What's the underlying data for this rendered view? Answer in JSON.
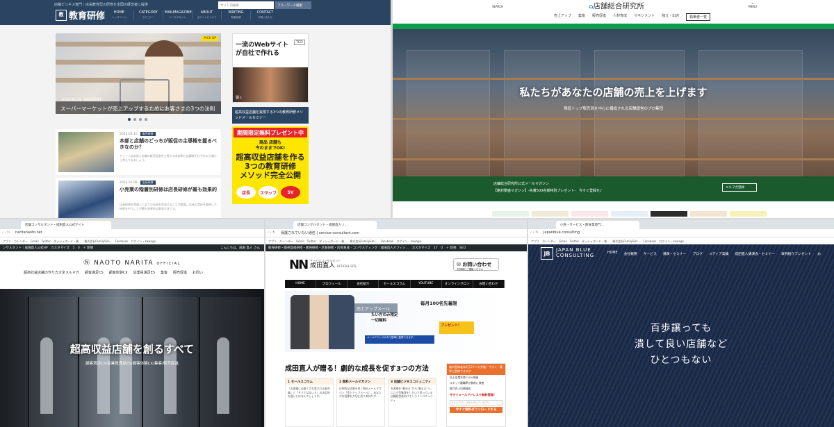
{
  "p1": {
    "tagline": "店舗ビジネス専門｜店長教育型の研修を全国の経営者に提供",
    "logo_icon": "教",
    "logo_text": "教育研修",
    "nav": [
      {
        "label": "HOME",
        "sub": "トップページ"
      },
      {
        "label": "CATEGORY",
        "sub": "カテゴリー"
      },
      {
        "label": "MAILMAGAZINE",
        "sub": "メールマガジン"
      },
      {
        "label": "ABOUT",
        "sub": "当サイトについて"
      },
      {
        "label": "WRITING",
        "sub": "執筆依頼"
      },
      {
        "label": "CONTACT",
        "sub": "お問い合わせ"
      }
    ],
    "search_placeholder": "サイト内検索",
    "search_button": "フリーワード検索",
    "hero": {
      "pickup": "PICK UP",
      "date": "2019.06.21 【店長研修】",
      "caption": "スーパーマーケットが売上アップするためにお客さまの3つの法則"
    },
    "articles": [
      {
        "date": "2022.02.10",
        "badge": "販売研修",
        "title": "本部と店舗のどっちが販促の主導権を握るべきなのか？",
        "excerpt": "チェーン店本部と店舗の販売促進を主導する本部側と店舗側それぞれの立場から考えてみましょう。"
      },
      {
        "date": "2022.02.08",
        "badge": "店長研修",
        "title": "小売業の階層別研修は店長研修が最も効果的",
        "excerpt": "店長研修を実施して全ての店長を育成することが重要。店長の育成を重視した研修を行うことが最も効果的な教育方法です。"
      }
    ],
    "ad1": {
      "title": "一流のWebサイト\nが自社で作れる",
      "logo": "TCD",
      "cta": "開く"
    },
    "side_title": "超高収益店舗を実現する3つの教育研修メソッドメールセミナー",
    "ad2": {
      "ribbon": "期間限定無料プレゼント中",
      "line1": "商品 店舗も\n今のままでOK!",
      "line2": "超高収益店舗を作る\n3つの教育研修\nメソッド完全公開",
      "tags": [
        "店長",
        "スタッフ",
        "SV"
      ]
    }
  },
  "p2": {
    "search_label": "SEARCH",
    "menu_label": "MENU",
    "logo": "店舗総合研究所",
    "nav": [
      "売上アップ",
      "集客",
      "販売促進",
      "人材育成",
      "マネジメント",
      "独立・出店"
    ],
    "nav_button": "執筆者一覧",
    "hero_title": "私たちがあなたの店舗の売上を上げます",
    "hero_sub": "現役トップ販売員を中心に構成される店舗運営のプロ集団",
    "mag_line1": "店舗総合研究所公式メールマガジン",
    "mag_line2": "【絶対繁盛マガジン】-先着500名様特別プレゼント-　今すぐ登録を♪",
    "mag_button": "メルマガ登録"
  },
  "p3": {
    "tab_label": "店舗コンサルタント・成田直人公式サイト",
    "url": "naritanaoto.net",
    "bookmarks": "アプリ　カレンダー　Gmail　Twitter　ダッシュボード ‹ 株…　株式会社FamilySmi…　Facebook　ログイン ‹ kawage…",
    "wp_bar": "ンサルタント｜成田直人公式HP　カスタマイズ　5　0　＋ 新規",
    "wp_user": "こんにちは、成田 直人 さん",
    "logo": "NAOTO NARITA",
    "logo_small": "OFFICIAL",
    "nav": [
      "超高収益店舗の作り方大全メルマガ",
      "顧客満足CS",
      "顧客体験CX",
      "従業員満足ES",
      "集客",
      "販売促進",
      "お問い"
    ],
    "hero_title": "超高収益店舗を創るすべて",
    "hero_sub": "顧客満足CS/従業員満足ES/顧客体験CX/集客/販売促進"
  },
  "p4": {
    "tab_label": "店舗コンサルタント・成田直人（…",
    "url": "保護されていない通信 | service-consultant.com",
    "bookmarks": "アプリ　カレンダー　Gmail　Twitter　ダッシュボード ‹ 株…　株式会社FamilySmi…　Facebook　ログイン ‹ kawage…",
    "wp_bar": "販売研修・販売促進研修・販売研修・店長研修・店長育成 - コンサルティング｜成田直人オフィシ…　カスタマイズ　17　0　＋ 新規　SEO",
    "logo_mark": "NN",
    "logo_sub": "サービスコンサルタント",
    "logo_name": "成田直人",
    "logo_official": "OFFICIAL SITE",
    "contact": "お問い合わせ",
    "contact_sub": "お気軽にご連絡ください",
    "nav": [
      "HOME",
      "プロフィール",
      "会社紹介",
      "セールスコラム",
      "YOUTUBE",
      "オンラインサロン",
      "お問い合わせ"
    ],
    "hero_bar": "売上アップメール",
    "hero_big": "毎月100名先着限",
    "hero_mid": "たい方のみ限定\n一切無料",
    "hero_blue": "メールアドレスのみで簡単に登録できます。",
    "hero_gift": "プレゼント!",
    "h2": "成田直人が贈る！劇的な成長を促す3つの方法",
    "cols": [
      {
        "title": "1 セールスコラム",
        "body": "「お客様に必要とされ愛される販売員」と「そうではない人」の決定的な違いとはなんでしょうか。"
      },
      {
        "title": "2 無料メールマガジン",
        "body": "圧倒的な成果を導く無料メールマガジン「売上アップメール」。あなたがお客様を大切に思う気持ちが…"
      },
      {
        "title": "3 店舗ビジネスコミュニティ",
        "body": "お客様を“集める”から“集まる”へ。口コミ型集客をしたいと思っている店舗経営者向けオンラインコミュニティ"
      }
    ],
    "side": {
      "head": "無料登録者は6万5千人を突破！今すぐ・簡単に登録できます",
      "items": [
        "売上倍増年商120%突破",
        "スタッフ離職率が劇的に改善",
        "毎月売上目標達成"
      ],
      "cta_text": "今すぐメールアドレスで無料登録！",
      "input": "メールアドレスを入力してください",
      "button": "今すぐ無料ダウンロードする"
    }
  },
  "p5": {
    "tab_label": "小売・サービス・飲食業専門…",
    "url": "japanblue.consulting",
    "bookmarks": "アプリ　カレンダー　Gmail　Twitter　ダッシュボード ‹ 株…　株式会社FamilySmi…　Facebook　ログイン ‹ kawage…",
    "logo_mark": "JB",
    "logo_line1": "JAPAN BLUE",
    "logo_line2": "CONSULTING",
    "nav": [
      "HOME",
      "会社概要",
      "サービス",
      "講演・セミナー",
      "ブログ",
      "メディア実績",
      "成田直人講演会・セミナー",
      "事例紹介ブレゼント",
      "お"
    ],
    "copy": [
      "百歩譲っても",
      "潰して良い店舗など",
      "ひとつもない"
    ]
  }
}
